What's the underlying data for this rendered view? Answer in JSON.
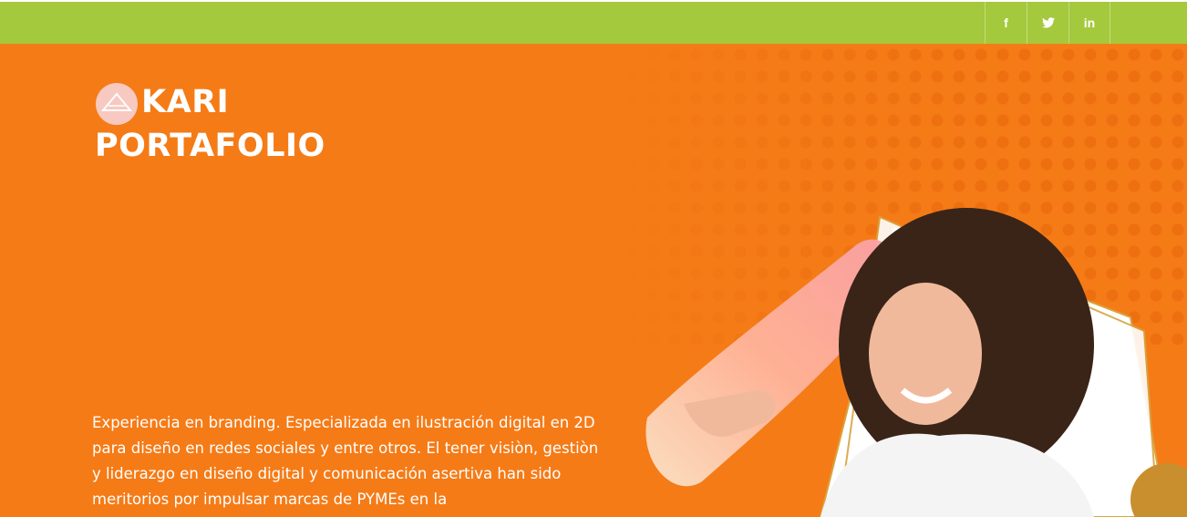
{
  "header": {
    "social": [
      {
        "icon": "facebook-icon",
        "glyph": "f"
      },
      {
        "icon": "twitter-icon",
        "glyph": "🐦"
      },
      {
        "icon": "linkedin-icon",
        "glyph": "in"
      }
    ]
  },
  "hero": {
    "brand_line1": "KARI",
    "brand_line2": "PORTAFOLIO",
    "intro": "Experiencia en branding. Especializada en ilustración digital en 2D para diseño en redes sociales y entre otros. El tener visiòn, gestiòn y liderazgo en diseño digital y comunicación asertiva han sido meritorios por impulsar marcas de PYMEs en la"
  },
  "colors": {
    "topbar": "#a4c93c",
    "hero_bg": "#f57b17",
    "text": "#ffffff"
  }
}
